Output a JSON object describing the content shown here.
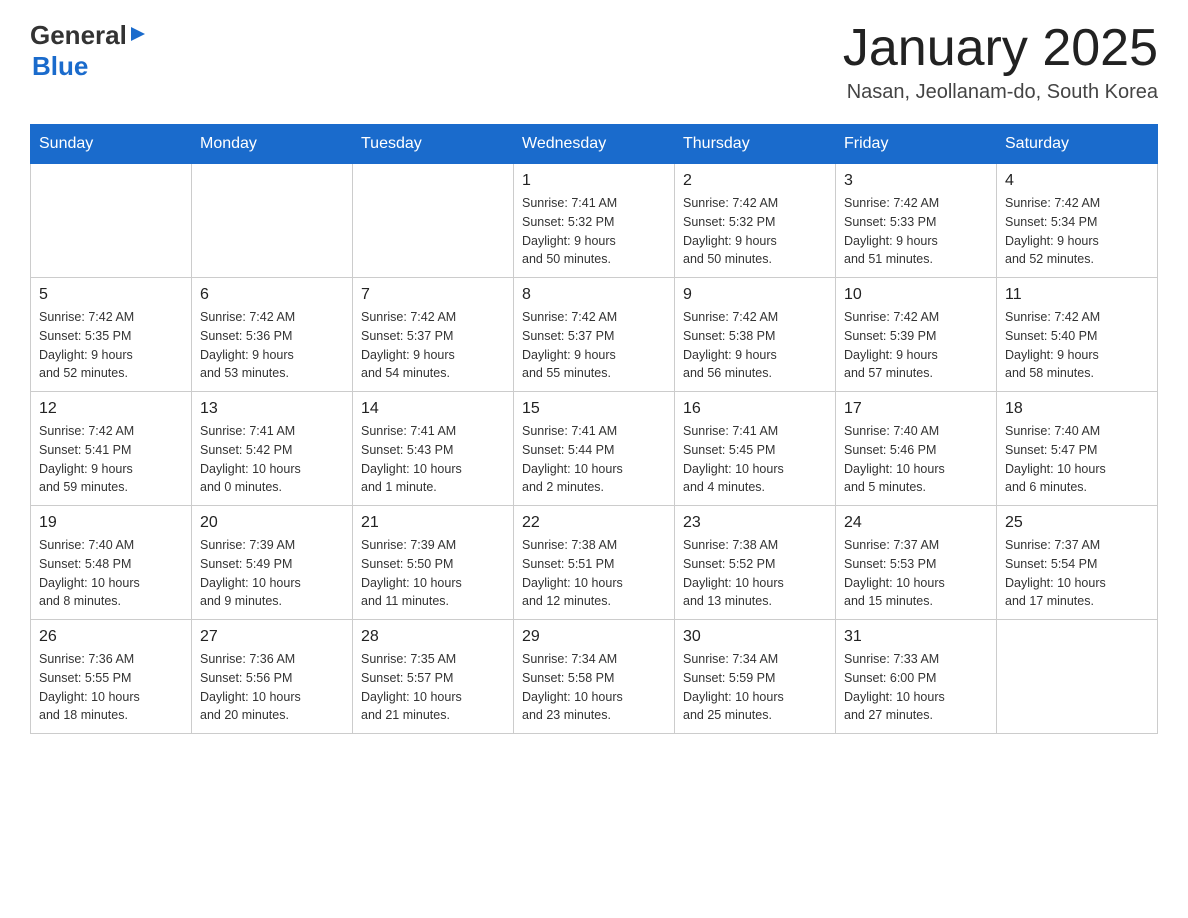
{
  "logo": {
    "general": "General",
    "arrow": "▶",
    "blue": "Blue"
  },
  "title": {
    "month": "January 2025",
    "location": "Nasan, Jeollanam-do, South Korea"
  },
  "days_of_week": [
    "Sunday",
    "Monday",
    "Tuesday",
    "Wednesday",
    "Thursday",
    "Friday",
    "Saturday"
  ],
  "weeks": [
    [
      {
        "day": "",
        "info": ""
      },
      {
        "day": "",
        "info": ""
      },
      {
        "day": "",
        "info": ""
      },
      {
        "day": "1",
        "info": "Sunrise: 7:41 AM\nSunset: 5:32 PM\nDaylight: 9 hours\nand 50 minutes."
      },
      {
        "day": "2",
        "info": "Sunrise: 7:42 AM\nSunset: 5:32 PM\nDaylight: 9 hours\nand 50 minutes."
      },
      {
        "day": "3",
        "info": "Sunrise: 7:42 AM\nSunset: 5:33 PM\nDaylight: 9 hours\nand 51 minutes."
      },
      {
        "day": "4",
        "info": "Sunrise: 7:42 AM\nSunset: 5:34 PM\nDaylight: 9 hours\nand 52 minutes."
      }
    ],
    [
      {
        "day": "5",
        "info": "Sunrise: 7:42 AM\nSunset: 5:35 PM\nDaylight: 9 hours\nand 52 minutes."
      },
      {
        "day": "6",
        "info": "Sunrise: 7:42 AM\nSunset: 5:36 PM\nDaylight: 9 hours\nand 53 minutes."
      },
      {
        "day": "7",
        "info": "Sunrise: 7:42 AM\nSunset: 5:37 PM\nDaylight: 9 hours\nand 54 minutes."
      },
      {
        "day": "8",
        "info": "Sunrise: 7:42 AM\nSunset: 5:37 PM\nDaylight: 9 hours\nand 55 minutes."
      },
      {
        "day": "9",
        "info": "Sunrise: 7:42 AM\nSunset: 5:38 PM\nDaylight: 9 hours\nand 56 minutes."
      },
      {
        "day": "10",
        "info": "Sunrise: 7:42 AM\nSunset: 5:39 PM\nDaylight: 9 hours\nand 57 minutes."
      },
      {
        "day": "11",
        "info": "Sunrise: 7:42 AM\nSunset: 5:40 PM\nDaylight: 9 hours\nand 58 minutes."
      }
    ],
    [
      {
        "day": "12",
        "info": "Sunrise: 7:42 AM\nSunset: 5:41 PM\nDaylight: 9 hours\nand 59 minutes."
      },
      {
        "day": "13",
        "info": "Sunrise: 7:41 AM\nSunset: 5:42 PM\nDaylight: 10 hours\nand 0 minutes."
      },
      {
        "day": "14",
        "info": "Sunrise: 7:41 AM\nSunset: 5:43 PM\nDaylight: 10 hours\nand 1 minute."
      },
      {
        "day": "15",
        "info": "Sunrise: 7:41 AM\nSunset: 5:44 PM\nDaylight: 10 hours\nand 2 minutes."
      },
      {
        "day": "16",
        "info": "Sunrise: 7:41 AM\nSunset: 5:45 PM\nDaylight: 10 hours\nand 4 minutes."
      },
      {
        "day": "17",
        "info": "Sunrise: 7:40 AM\nSunset: 5:46 PM\nDaylight: 10 hours\nand 5 minutes."
      },
      {
        "day": "18",
        "info": "Sunrise: 7:40 AM\nSunset: 5:47 PM\nDaylight: 10 hours\nand 6 minutes."
      }
    ],
    [
      {
        "day": "19",
        "info": "Sunrise: 7:40 AM\nSunset: 5:48 PM\nDaylight: 10 hours\nand 8 minutes."
      },
      {
        "day": "20",
        "info": "Sunrise: 7:39 AM\nSunset: 5:49 PM\nDaylight: 10 hours\nand 9 minutes."
      },
      {
        "day": "21",
        "info": "Sunrise: 7:39 AM\nSunset: 5:50 PM\nDaylight: 10 hours\nand 11 minutes."
      },
      {
        "day": "22",
        "info": "Sunrise: 7:38 AM\nSunset: 5:51 PM\nDaylight: 10 hours\nand 12 minutes."
      },
      {
        "day": "23",
        "info": "Sunrise: 7:38 AM\nSunset: 5:52 PM\nDaylight: 10 hours\nand 13 minutes."
      },
      {
        "day": "24",
        "info": "Sunrise: 7:37 AM\nSunset: 5:53 PM\nDaylight: 10 hours\nand 15 minutes."
      },
      {
        "day": "25",
        "info": "Sunrise: 7:37 AM\nSunset: 5:54 PM\nDaylight: 10 hours\nand 17 minutes."
      }
    ],
    [
      {
        "day": "26",
        "info": "Sunrise: 7:36 AM\nSunset: 5:55 PM\nDaylight: 10 hours\nand 18 minutes."
      },
      {
        "day": "27",
        "info": "Sunrise: 7:36 AM\nSunset: 5:56 PM\nDaylight: 10 hours\nand 20 minutes."
      },
      {
        "day": "28",
        "info": "Sunrise: 7:35 AM\nSunset: 5:57 PM\nDaylight: 10 hours\nand 21 minutes."
      },
      {
        "day": "29",
        "info": "Sunrise: 7:34 AM\nSunset: 5:58 PM\nDaylight: 10 hours\nand 23 minutes."
      },
      {
        "day": "30",
        "info": "Sunrise: 7:34 AM\nSunset: 5:59 PM\nDaylight: 10 hours\nand 25 minutes."
      },
      {
        "day": "31",
        "info": "Sunrise: 7:33 AM\nSunset: 6:00 PM\nDaylight: 10 hours\nand 27 minutes."
      },
      {
        "day": "",
        "info": ""
      }
    ]
  ]
}
